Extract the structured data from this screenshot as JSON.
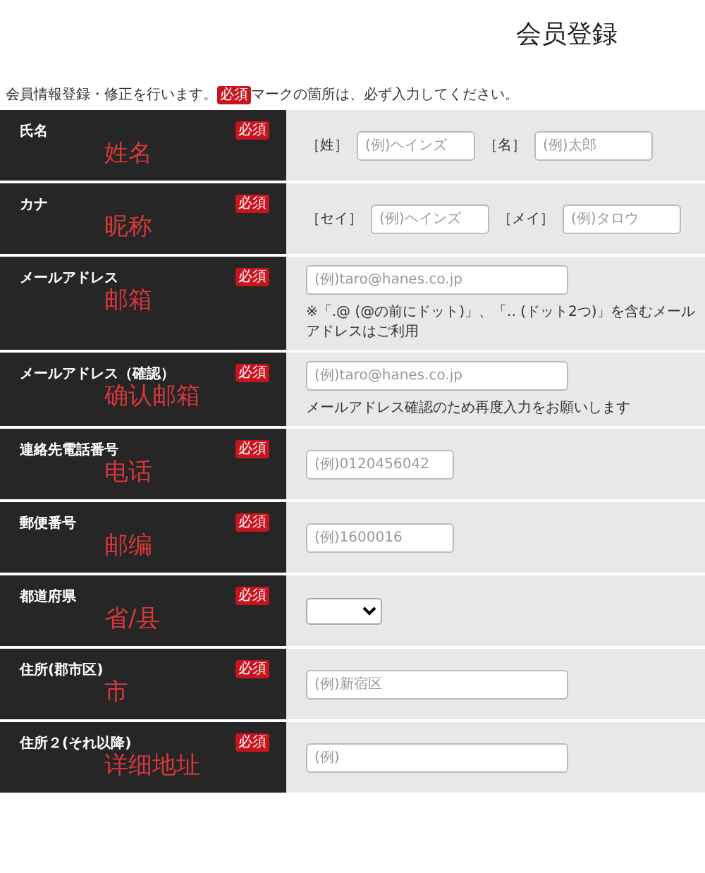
{
  "page": {
    "title": "会员登録",
    "intro_before": "会員情報登録・修正を行います。",
    "intro_badge": "必須",
    "intro_after": "マークの箇所は、必ず入力してください。"
  },
  "rows": [
    {
      "label": "氏名",
      "required": true,
      "badge": "必須",
      "annotation": "姓名",
      "fields": [
        {
          "kind": "text",
          "prefix": "［姓］",
          "placeholder": "(例)ヘインズ"
        },
        {
          "kind": "text",
          "prefix": "［名］",
          "placeholder": "(例)太郎"
        }
      ]
    },
    {
      "label": "カナ",
      "required": true,
      "badge": "必須",
      "annotation": "昵称",
      "fields": [
        {
          "kind": "text",
          "prefix": "［セイ］",
          "placeholder": "(例)ヘインズ"
        },
        {
          "kind": "text",
          "prefix": "［メイ］",
          "placeholder": "(例)タロウ"
        }
      ]
    },
    {
      "label": "メールアドレス",
      "required": true,
      "badge": "必須",
      "annotation": "邮箱",
      "fields": [
        {
          "kind": "wide",
          "placeholder": "(例)taro@hanes.co.jp"
        }
      ],
      "note": "※「.@ (@の前にドット)」、「.. (ドット2つ)」を含むメールアドレスはご利用"
    },
    {
      "label": "メールアドレス（確認）",
      "required": true,
      "badge": "必須",
      "annotation": "确认邮箱",
      "fields": [
        {
          "kind": "wide",
          "placeholder": "(例)taro@hanes.co.jp"
        }
      ],
      "note": "メールアドレス確認のため再度入力をお願いします"
    },
    {
      "label": "連絡先電話番号",
      "required": true,
      "badge": "必須",
      "annotation": "电话",
      "fields": [
        {
          "kind": "short",
          "placeholder": "(例)0120456042"
        }
      ]
    },
    {
      "label": "郵便番号",
      "required": true,
      "badge": "必須",
      "annotation": "邮编",
      "fields": [
        {
          "kind": "short",
          "placeholder": "(例)1600016"
        }
      ]
    },
    {
      "label": "都道府県",
      "required": true,
      "badge": "必須",
      "annotation": "省/县",
      "fields": [
        {
          "kind": "select"
        }
      ]
    },
    {
      "label": "住所(郡市区)",
      "required": true,
      "badge": "必須",
      "annotation": "市",
      "fields": [
        {
          "kind": "wide",
          "placeholder": "(例)新宿区"
        }
      ]
    },
    {
      "label": "住所２(それ以降)",
      "required": true,
      "badge": "必須",
      "annotation": "详细地址",
      "fields": [
        {
          "kind": "wide",
          "placeholder": "(例)"
        }
      ]
    }
  ]
}
